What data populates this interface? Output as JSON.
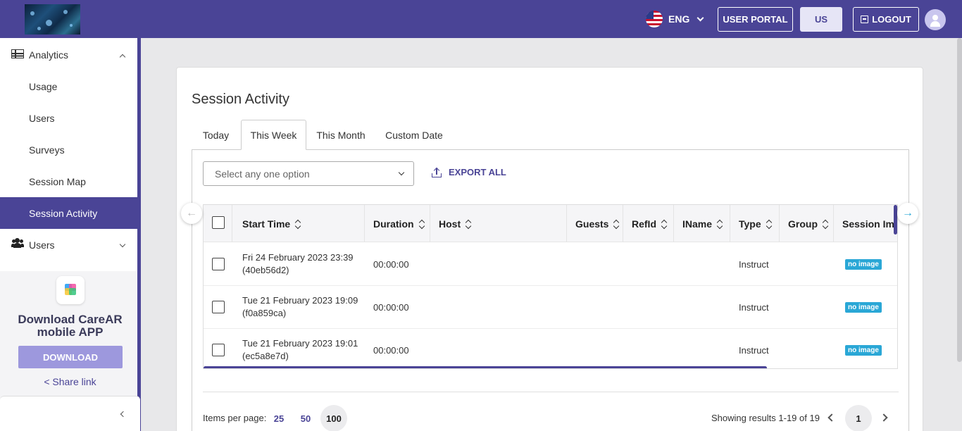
{
  "header": {
    "language": "ENG",
    "user_portal_label": "USER PORTAL",
    "region_label": "US",
    "logout_label": "LOGOUT"
  },
  "sidebar": {
    "analytics_label": "Analytics",
    "items": [
      {
        "label": "Usage"
      },
      {
        "label": "Users"
      },
      {
        "label": "Surveys"
      },
      {
        "label": "Session Map"
      },
      {
        "label": "Session Activity"
      }
    ],
    "users_label": "Users",
    "download_title": "Download CareAR mobile APP",
    "download_button": "DOWNLOAD",
    "share_link": "< Share link"
  },
  "main": {
    "title": "Session Activity",
    "tabs": [
      {
        "label": "Today"
      },
      {
        "label": "This Week"
      },
      {
        "label": "This Month"
      },
      {
        "label": "Custom Date"
      }
    ],
    "active_tab": "This Week",
    "filter_placeholder": "Select any one option",
    "export_label": "EXPORT ALL",
    "columns": [
      "Start Time",
      "Duration",
      "Host",
      "Guests",
      "RefId",
      "IName",
      "Type",
      "Group",
      "Session Imag"
    ],
    "rows": [
      {
        "start": "Fri 24 February 2023 23:39",
        "id": "(40eb56d2)",
        "duration": "00:00:00",
        "type": "Instruct",
        "image": "no image"
      },
      {
        "start": "Tue 21 February 2023 19:09",
        "id": "(f0a859ca)",
        "duration": "00:00:00",
        "type": "Instruct",
        "image": "no image"
      },
      {
        "start": "Tue 21 February 2023 19:01",
        "id": "(ec5a8e7d)",
        "duration": "00:00:00",
        "type": "Instruct",
        "image": "no image"
      }
    ],
    "pagination": {
      "items_per_page_label": "Items per page:",
      "options": [
        "25",
        "50",
        "100"
      ],
      "selected": "100",
      "results_text": "Showing results 1-19 of 19",
      "page": "1"
    }
  },
  "colors": {
    "brand": "#4a4496",
    "badge": "#2aa7d6",
    "download_button": "#9d98dd"
  },
  "icons": {
    "analytics": "table-icon",
    "users": "users-icon",
    "export": "upload-icon",
    "logout": "logout-icon",
    "share": "share-icon",
    "scroll_left": "arrow-left-icon",
    "scroll_right": "arrow-right-icon"
  }
}
